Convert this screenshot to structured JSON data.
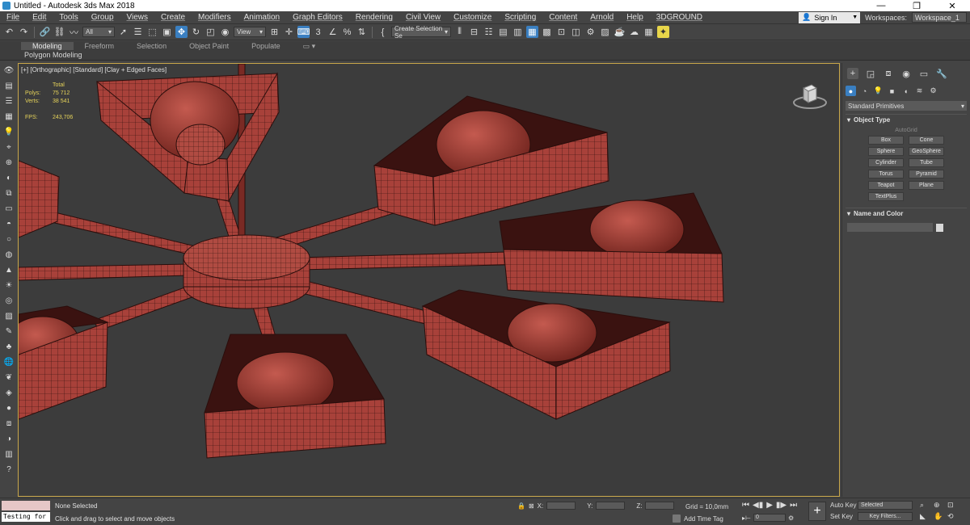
{
  "window": {
    "title": "Untitled - Autodesk 3ds Max 2018",
    "buttons": [
      "—",
      "❐",
      "✕"
    ]
  },
  "menubar": {
    "items": [
      "File",
      "Edit",
      "Tools",
      "Group",
      "Views",
      "Create",
      "Modifiers",
      "Animation",
      "Graph Editors",
      "Rendering",
      "Civil View",
      "Customize",
      "Scripting",
      "Content",
      "Arnold",
      "Help",
      "3DGROUND"
    ],
    "sign_in": "Sign In",
    "workspaces_label": "Workspaces:",
    "workspace_value": "Workspace_1"
  },
  "toolbar": {
    "filter_value": "All",
    "reference_value": "View",
    "selection_set_placeholder": "Create Selection Se",
    "icons": [
      "undo-icon",
      "redo-icon",
      "link-icon",
      "unlink-icon",
      "bind-icon",
      "select-icon",
      "select-by-name-icon",
      "rect-select-icon",
      "window-crossing-icon",
      "move-icon",
      "rotate-icon",
      "scale-icon",
      "place-icon",
      "snaps-icon",
      "angle-snap-icon",
      "percent-snap-icon",
      "spinner-snap-icon",
      "mirror-icon",
      "align-icon",
      "layer-icon",
      "scene-explorer-icon",
      "curve-editor-icon",
      "schematic-icon",
      "material-editor-icon",
      "render-setup-icon",
      "render-frame-icon",
      "render-icon"
    ]
  },
  "ribbon": {
    "tabs": [
      "Modeling",
      "Freeform",
      "Selection",
      "Object Paint",
      "Populate"
    ],
    "active_tab": "Modeling",
    "subtitle": "Polygon Modeling"
  },
  "viewport": {
    "label": "[+] [Orthographic] [Standard] [Clay + Edged Faces]",
    "stats": {
      "total_label": "Total",
      "polys_label": "Polys:",
      "polys_value": "75 712",
      "verts_label": "Verts:",
      "verts_value": "38 541",
      "fps_label": "FPS:",
      "fps_value": "243,706"
    },
    "colors": {
      "background": "#3c3c3c",
      "model_fill": "#a8413a",
      "wire": "#2a0e0c",
      "border": "#c8a74a"
    }
  },
  "command_panel": {
    "primitive_type": "Standard Primitives",
    "object_type_title": "Object Type",
    "autogrid_label": "AutoGrid",
    "buttons": [
      "Box",
      "Cone",
      "Sphere",
      "GeoSphere",
      "Cylinder",
      "Tube",
      "Torus",
      "Pyramid",
      "Teapot",
      "Plane",
      "TextPlus"
    ],
    "name_color_title": "Name and Color"
  },
  "statusbar": {
    "maxscript_text": "Testing for :",
    "selection": "None Selected",
    "prompt": "Click and drag to select and move objects",
    "x_label": "X:",
    "y_label": "Y:",
    "z_label": "Z:",
    "grid": "Grid = 10,0mm",
    "add_time_tag": "Add Time Tag",
    "frame_value": "0",
    "auto_key": "Auto Key",
    "set_key": "Set Key",
    "selected_value": "Selected",
    "key_filters": "Key Filters..."
  }
}
